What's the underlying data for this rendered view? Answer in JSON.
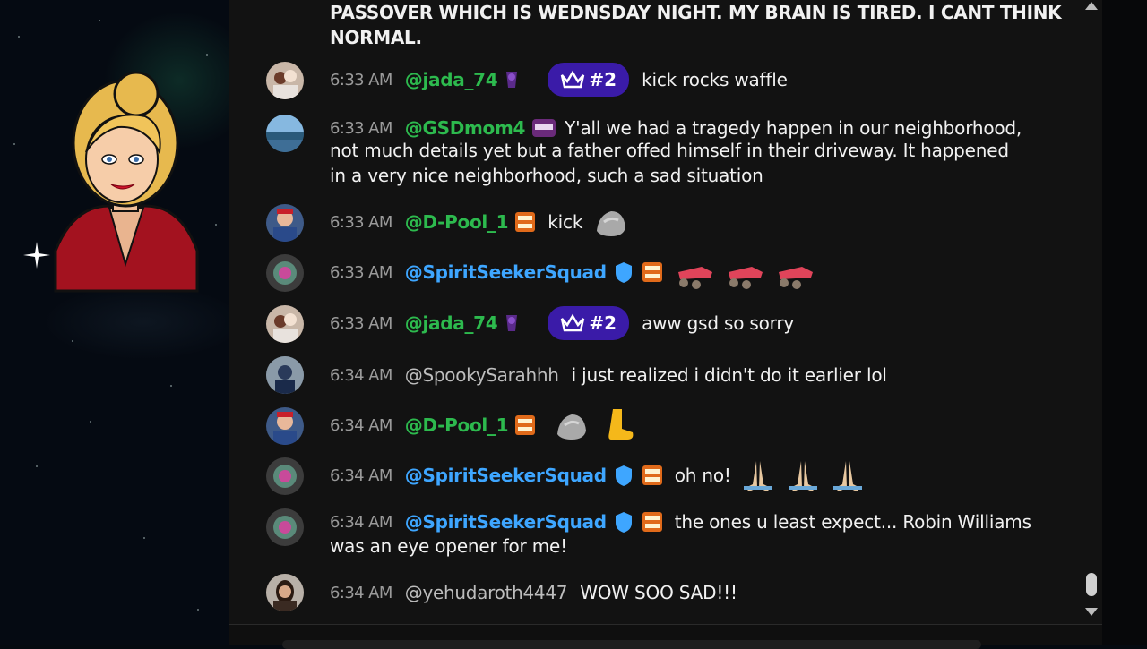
{
  "chat": {
    "top_message": {
      "line1": "PASSOVER WHICH IS WEDNSDAY NIGHT. MY BRAIN IS TIRED. I CANT THINK",
      "line2": "NORMAL."
    },
    "messages": [
      {
        "time": "6:33 AM",
        "author": "@jada_74",
        "rank": "#2",
        "text": "kick rocks waffle"
      },
      {
        "time": "6:33 AM",
        "author": "@GSDmom4",
        "text": "Y'all we had a tragedy happen in our neighborhood,",
        "text2": "not much details yet but a father offed himself in their driveway. It happened",
        "text3": "in a very nice neighborhood, such a sad situation"
      },
      {
        "time": "6:33 AM",
        "author": "@D-Pool_1",
        "text": "kick"
      },
      {
        "time": "6:33 AM",
        "author": "@SpiritSeekerSquad",
        "text": ""
      },
      {
        "time": "6:33 AM",
        "author": "@jada_74",
        "rank": "#2",
        "text": "aww gsd so sorry"
      },
      {
        "time": "6:34 AM",
        "author": "@SpookySarahhh",
        "text": "i just realized i didn't do it earlier lol"
      },
      {
        "time": "6:34 AM",
        "author": "@D-Pool_1",
        "text": ""
      },
      {
        "time": "6:34 AM",
        "author": "@SpiritSeekerSquad",
        "text": "oh no!"
      },
      {
        "time": "6:34 AM",
        "author": "@SpiritSeekerSquad",
        "text": "the ones u least expect... Robin Williams",
        "text2": "was an eye opener for me!"
      },
      {
        "time": "6:34 AM",
        "author": "@yehudaroth4447",
        "text": "WOW SOO SAD!!!"
      }
    ]
  },
  "colors": {
    "member_name": "#2dba4e",
    "verified_name": "#3ea6ff",
    "regular_name": "#bdbdbd",
    "rank_badge": "#3a1ba8",
    "chat_bg": "#121212"
  },
  "icons": [
    "crown-icon",
    "verified-shield-icon",
    "rock-emoji",
    "sneaker-emoji",
    "foot-emoji",
    "pray-emoji",
    "scroll-up-arrow",
    "scroll-down-arrow"
  ]
}
